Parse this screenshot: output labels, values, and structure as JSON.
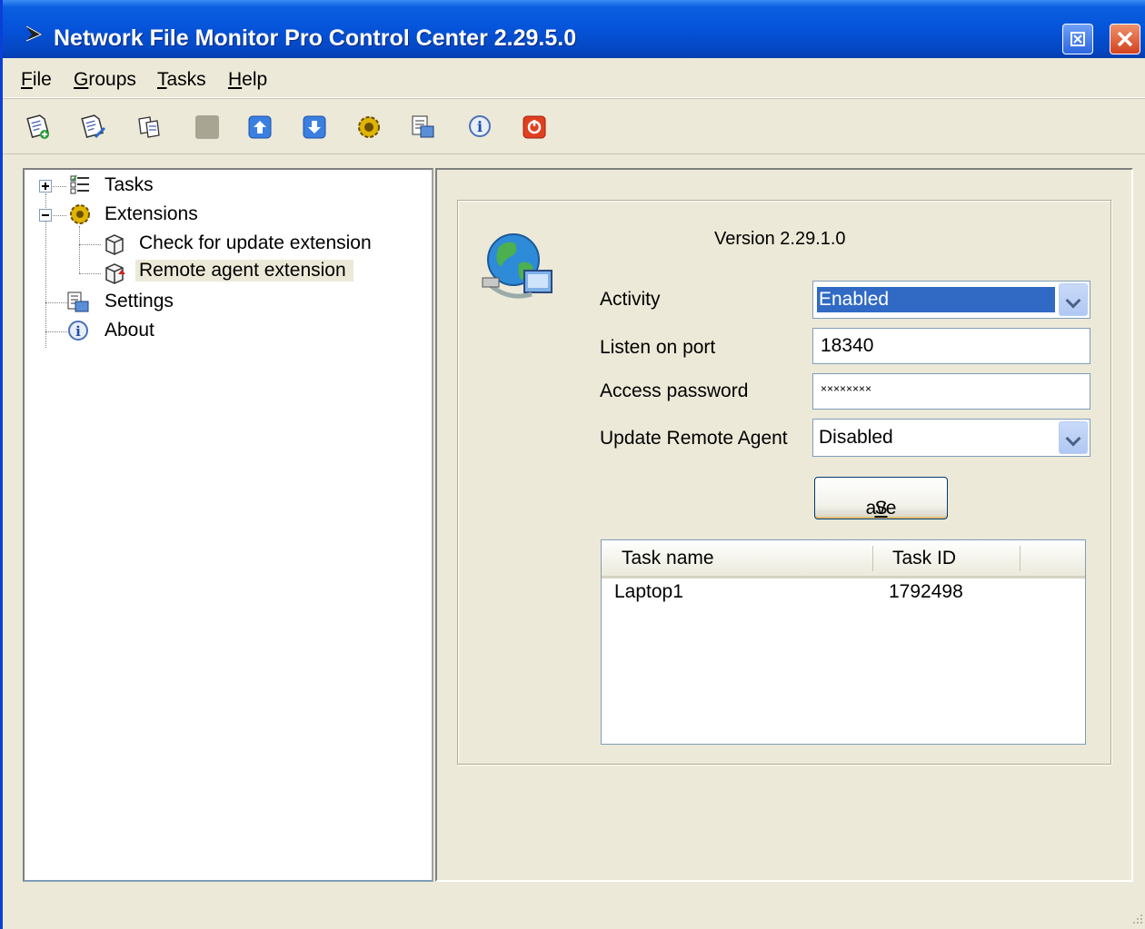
{
  "window": {
    "title": "Network File Monitor Pro Control Center 2.29.5.0"
  },
  "menu": {
    "items": [
      {
        "label": "File",
        "accel": "F",
        "rest": "ile"
      },
      {
        "label": "Groups",
        "accel": "G",
        "rest": "roups"
      },
      {
        "label": "Tasks",
        "accel": "T",
        "rest": "asks"
      },
      {
        "label": "Help",
        "accel": "H",
        "rest": "elp"
      }
    ]
  },
  "toolbar": {
    "icons": [
      "new-task-icon",
      "edit-task-icon",
      "copy-task-icon",
      "stop-icon",
      "move-up-icon",
      "move-down-icon",
      "extensions-icon",
      "settings-icon",
      "about-icon",
      "exit-icon"
    ]
  },
  "tree": {
    "items": [
      {
        "label": "Tasks",
        "expanded": false
      },
      {
        "label": "Extensions",
        "expanded": true
      },
      {
        "label": "Check for update extension"
      },
      {
        "label": "Remote agent extension",
        "selected": true
      },
      {
        "label": "Settings"
      },
      {
        "label": "About"
      }
    ]
  },
  "panel": {
    "version": "Version 2.29.1.0",
    "fields": {
      "activity_label": "Activity",
      "activity_value": "Enabled",
      "port_label": "Listen on port",
      "port_value": "18340",
      "password_label": "Access password",
      "password_value": "××××××××",
      "update_label": "Update Remote Agent",
      "update_value": "Disabled"
    },
    "save_accel": "S",
    "save_rest": "ave",
    "list": {
      "columns": [
        "Task name",
        "Task ID"
      ],
      "rows": [
        {
          "name": "Laptop1",
          "id": "1792498"
        }
      ]
    }
  },
  "colors": {
    "titlebar": "#0553D9",
    "selection": "#316AC5",
    "face": "#ECE9D8"
  }
}
